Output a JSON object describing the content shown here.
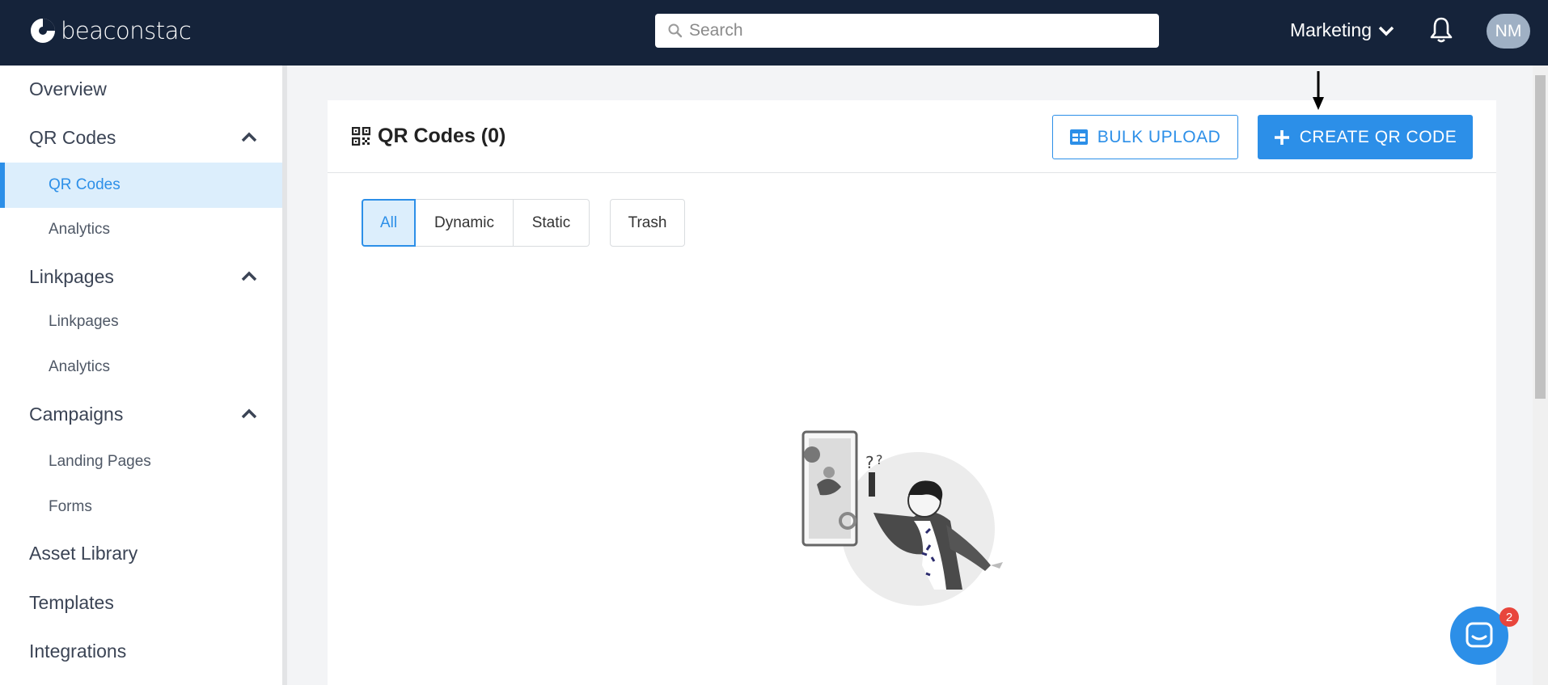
{
  "header": {
    "logo_text": "beaconstac",
    "search_placeholder": "Search",
    "workspace": "Marketing",
    "avatar_initials": "NM"
  },
  "sidebar": {
    "items": [
      {
        "label": "Overview"
      },
      {
        "label": "QR Codes",
        "expanded": true
      },
      {
        "label": "QR Codes",
        "active": true
      },
      {
        "label": "Analytics"
      },
      {
        "label": "Linkpages",
        "expanded": true
      },
      {
        "label": "Linkpages"
      },
      {
        "label": "Analytics"
      },
      {
        "label": "Campaigns",
        "expanded": true
      },
      {
        "label": "Landing Pages"
      },
      {
        "label": "Forms"
      },
      {
        "label": "Asset Library"
      },
      {
        "label": "Templates"
      },
      {
        "label": "Integrations"
      }
    ]
  },
  "main": {
    "title": "QR Codes (0)",
    "bulk_upload_label": "BULK UPLOAD",
    "create_label": "CREATE QR CODE",
    "filters": [
      "All",
      "Dynamic",
      "Static",
      "Trash"
    ],
    "active_filter": "All"
  },
  "chat": {
    "badge_count": "2"
  },
  "colors": {
    "nav_bg": "#15233a",
    "accent": "#2c8fe8",
    "active_bg": "#dceefc",
    "badge": "#e8453c"
  }
}
